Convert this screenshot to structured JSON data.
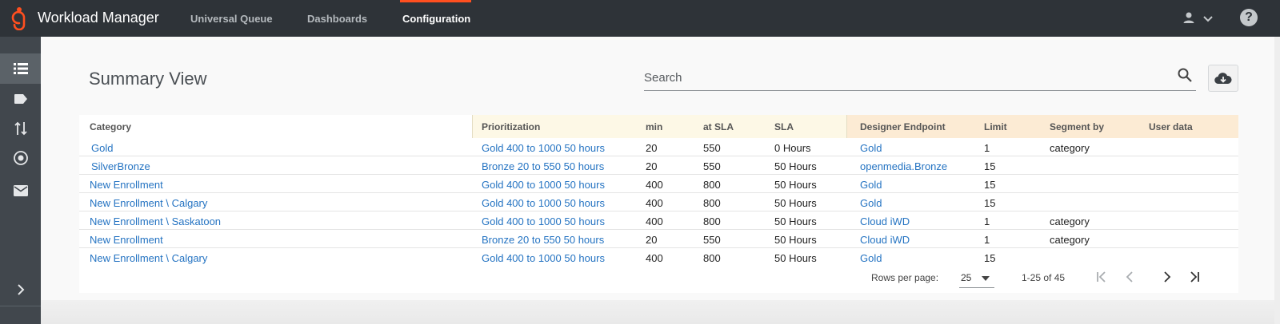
{
  "app": {
    "title": "Workload Manager",
    "brand_color": "#ff4f1f"
  },
  "nav": {
    "tabs": [
      {
        "label": "Universal Queue",
        "active": false
      },
      {
        "label": "Dashboards",
        "active": false
      },
      {
        "label": "Configuration",
        "active": true
      }
    ]
  },
  "header_icons": {
    "user": "user-icon",
    "menu": "chevron-down-icon",
    "help": "?"
  },
  "sidebar": {
    "items": [
      {
        "icon": "list-icon",
        "active": true
      },
      {
        "icon": "tag-icon",
        "active": false
      },
      {
        "icon": "sort-arrows-icon",
        "active": false
      },
      {
        "icon": "target-icon",
        "active": false
      },
      {
        "icon": "mail-icon",
        "active": false
      }
    ],
    "expand_icon": "chevron-right-icon"
  },
  "page": {
    "title": "Summary View"
  },
  "search": {
    "placeholder": "Search",
    "value": ""
  },
  "table": {
    "columns": [
      "Category",
      "Prioritization",
      "min",
      "at SLA",
      "SLA",
      "Designer Endpoint",
      "Limit",
      "Segment by",
      "User data"
    ],
    "rows": [
      {
        "category": "Gold",
        "prioritization": "Gold 400 to 1000 50 hours",
        "min": "20",
        "at_sla": "550",
        "sla": "0 Hours",
        "endpoint": "Gold",
        "limit": "1",
        "segment_by": "category",
        "user_data": ""
      },
      {
        "category": "SilverBronze",
        "prioritization": "Bronze 20 to 550 50 hours",
        "min": "20",
        "at_sla": "550",
        "sla": "50 Hours",
        "endpoint": "openmedia.Bronze",
        "limit": "15",
        "segment_by": "",
        "user_data": ""
      },
      {
        "category": "New Enrollment",
        "prioritization": "Gold 400 to 1000 50 hours",
        "min": "400",
        "at_sla": "800",
        "sla": "50 Hours",
        "endpoint": "Gold",
        "limit": "15",
        "segment_by": "",
        "user_data": ""
      },
      {
        "category": "New Enrollment \\ Calgary",
        "prioritization": "Gold 400 to 1000 50 hours",
        "min": "400",
        "at_sla": "800",
        "sla": "50 Hours",
        "endpoint": "Gold",
        "limit": "15",
        "segment_by": "",
        "user_data": ""
      },
      {
        "category": "New Enrollment \\ Saskatoon",
        "prioritization": "Gold 400 to 1000 50 hours",
        "min": "400",
        "at_sla": "800",
        "sla": "50 Hours",
        "endpoint": "Cloud iWD",
        "limit": "1",
        "segment_by": "category",
        "user_data": ""
      },
      {
        "category": "New Enrollment",
        "prioritization": "Bronze 20 to 550 50 hours",
        "min": "20",
        "at_sla": "550",
        "sla": "50 Hours",
        "endpoint": "Cloud iWD",
        "limit": "1",
        "segment_by": "category",
        "user_data": ""
      },
      {
        "category": "New Enrollment \\ Calgary",
        "prioritization": "Gold 400 to 1000 50 hours",
        "min": "400",
        "at_sla": "800",
        "sla": "50 Hours",
        "endpoint": "Gold",
        "limit": "15",
        "segment_by": "",
        "user_data": ""
      }
    ]
  },
  "pagination": {
    "rows_per_page_label": "Rows per page:",
    "rows_per_page": "25",
    "range": "1-25 of 45",
    "buttons": [
      "first-page-icon",
      "prev-page-icon",
      "next-page-icon",
      "last-page-icon"
    ]
  },
  "actions": {
    "download_icon": "cloud-download-icon"
  }
}
